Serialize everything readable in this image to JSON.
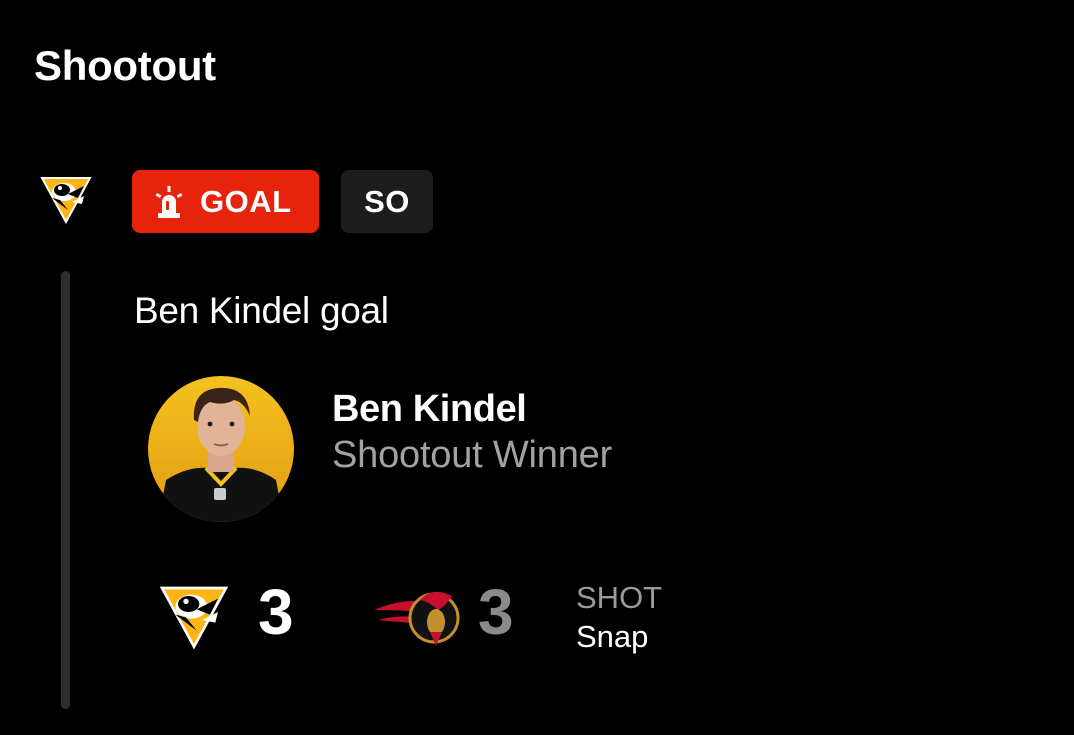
{
  "section": {
    "title": "Shootout"
  },
  "event": {
    "team_logo_icon": "penguins-logo-icon",
    "badges": {
      "goal_label": "GOAL",
      "goal_icon": "siren-icon",
      "goal_color": "#e8230c",
      "period_label": "SO"
    },
    "description": "Ben Kindel goal",
    "player": {
      "name": "Ben Kindel",
      "role": "Shootout Winner",
      "avatar_bg": "#f0b41e"
    },
    "score": {
      "home": {
        "team_icon": "penguins-logo-icon",
        "value": "3"
      },
      "away": {
        "team_icon": "senators-logo-icon",
        "value": "3"
      }
    },
    "shot": {
      "label": "SHOT",
      "value": "Snap"
    }
  }
}
